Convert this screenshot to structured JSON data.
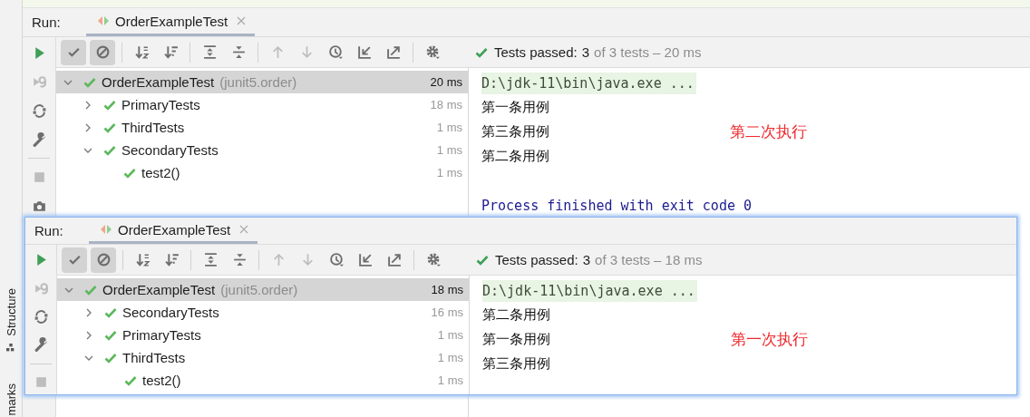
{
  "ide_strip": {
    "labels": [
      {
        "text": "Structure",
        "kind": "structure"
      },
      {
        "text": "marks",
        "kind": "bookmarks"
      }
    ]
  },
  "panels": [
    {
      "run_label": "Run:",
      "tab": {
        "title": "OrderExampleTest",
        "selected": true
      },
      "side_tools": [
        {
          "kind": "run",
          "disabled": false
        },
        {
          "kind": "rerun-failed",
          "disabled": true
        },
        {
          "kind": "auto-test",
          "disabled": false
        },
        {
          "kind": "wrench",
          "disabled": false
        },
        {
          "kind": "stop",
          "disabled": true
        },
        {
          "kind": "camera",
          "disabled": false
        }
      ],
      "toolbar_groups": [
        [
          {
            "kind": "show-passed",
            "on": true,
            "disabled": false
          },
          {
            "kind": "show-ignored",
            "on": true,
            "disabled": false
          }
        ],
        [
          {
            "kind": "sort-alpha",
            "on": false,
            "disabled": false
          },
          {
            "kind": "sort-duration",
            "on": false,
            "disabled": false
          }
        ],
        [
          {
            "kind": "expand-all",
            "on": false,
            "disabled": false
          },
          {
            "kind": "collapse-all",
            "on": false,
            "disabled": false
          }
        ],
        [
          {
            "kind": "previous",
            "on": false,
            "disabled": true
          },
          {
            "kind": "next",
            "on": false,
            "disabled": true
          },
          {
            "kind": "history",
            "on": false,
            "disabled": false
          },
          {
            "kind": "import",
            "on": false,
            "disabled": false
          },
          {
            "kind": "export",
            "on": false,
            "disabled": false
          }
        ],
        [
          {
            "kind": "settings",
            "on": false,
            "disabled": false
          }
        ]
      ],
      "status": {
        "label": "Tests passed:",
        "count": "3",
        "detail": "of 3 tests – 20 ms"
      },
      "tree": {
        "name": "OrderExampleTest",
        "package": "(junit5.order)",
        "time": "20 ms",
        "selected": true,
        "expanded": true,
        "children": [
          {
            "name": "PrimaryTests",
            "time": "18 ms",
            "selected": false,
            "expanded": false
          },
          {
            "name": "ThirdTests",
            "time": "1 ms",
            "selected": false,
            "expanded": false
          },
          {
            "name": "SecondaryTests",
            "time": "1 ms",
            "selected": false,
            "expanded": true,
            "children": [
              {
                "name": "test2()",
                "time": "1 ms",
                "selected": false
              }
            ]
          }
        ]
      },
      "console": {
        "command": "D:\\jdk-11\\bin\\java.exe ...",
        "lines": [
          "第一条用例",
          "第三条用例",
          "第二条用例"
        ],
        "exit": "Process finished with exit code 0"
      },
      "annotation": "第二次执行"
    },
    {
      "run_label": "Run:",
      "tab": {
        "title": "OrderExampleTest",
        "selected": true
      },
      "side_tools": [
        {
          "kind": "run",
          "disabled": false
        },
        {
          "kind": "rerun-failed",
          "disabled": true
        },
        {
          "kind": "auto-test",
          "disabled": false
        },
        {
          "kind": "wrench",
          "disabled": false
        },
        {
          "kind": "stop",
          "disabled": true
        }
      ],
      "toolbar_groups": [
        [
          {
            "kind": "show-passed",
            "on": true,
            "disabled": false
          },
          {
            "kind": "show-ignored",
            "on": true,
            "disabled": false
          }
        ],
        [
          {
            "kind": "sort-alpha",
            "on": false,
            "disabled": false
          },
          {
            "kind": "sort-duration",
            "on": false,
            "disabled": false
          }
        ],
        [
          {
            "kind": "expand-all",
            "on": false,
            "disabled": false
          },
          {
            "kind": "collapse-all",
            "on": false,
            "disabled": false
          }
        ],
        [
          {
            "kind": "previous",
            "on": false,
            "disabled": true
          },
          {
            "kind": "next",
            "on": false,
            "disabled": true
          },
          {
            "kind": "history",
            "on": false,
            "disabled": false
          },
          {
            "kind": "import",
            "on": false,
            "disabled": false
          },
          {
            "kind": "export",
            "on": false,
            "disabled": false
          }
        ],
        [
          {
            "kind": "settings",
            "on": false,
            "disabled": false
          }
        ]
      ],
      "status": {
        "label": "Tests passed:",
        "count": "3",
        "detail": "of 3 tests – 18 ms"
      },
      "tree": {
        "name": "OrderExampleTest",
        "package": "(junit5.order)",
        "time": "18 ms",
        "selected": true,
        "expanded": true,
        "children": [
          {
            "name": "SecondaryTests",
            "time": "16 ms",
            "selected": false,
            "expanded": false
          },
          {
            "name": "PrimaryTests",
            "time": "1 ms",
            "selected": false,
            "expanded": false
          },
          {
            "name": "ThirdTests",
            "time": "1 ms",
            "selected": false,
            "expanded": true,
            "children": [
              {
                "name": "test2()",
                "time": "1 ms",
                "selected": false
              }
            ]
          }
        ]
      },
      "console": {
        "command": "D:\\jdk-11\\bin\\java.exe ...",
        "lines": [
          "第二条用例",
          "第一条用例",
          "第三条用例"
        ]
      },
      "annotation": "第一次执行"
    }
  ]
}
